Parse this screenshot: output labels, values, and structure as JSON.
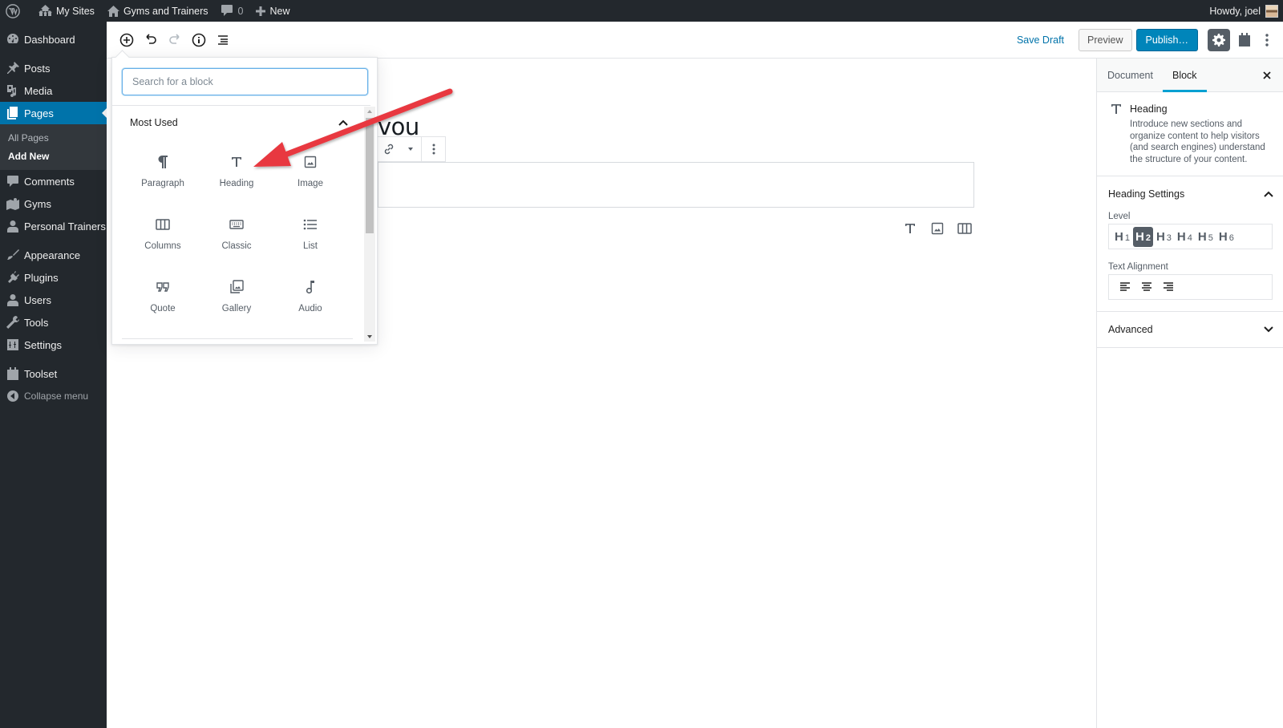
{
  "admin_bar": {
    "wp_logo": "wordpress-logo",
    "my_sites": "My Sites",
    "site_name": "Gyms and Trainers",
    "comments_count": "0",
    "new_label": "New",
    "greeting": "Howdy, joel"
  },
  "admin_menu": {
    "items": [
      {
        "label": "Dashboard",
        "icon": "dashboard-icon"
      },
      {
        "label": "Posts",
        "icon": "pin-icon"
      },
      {
        "label": "Media",
        "icon": "media-icon"
      },
      {
        "label": "Pages",
        "icon": "pages-icon",
        "current": true
      },
      {
        "label": "Comments",
        "icon": "comment-icon"
      },
      {
        "label": "Gyms",
        "icon": "map-icon"
      },
      {
        "label": "Personal Trainers",
        "icon": "user-icon"
      },
      {
        "label": "Appearance",
        "icon": "brush-icon"
      },
      {
        "label": "Plugins",
        "icon": "plug-icon"
      },
      {
        "label": "Users",
        "icon": "user-icon"
      },
      {
        "label": "Tools",
        "icon": "wrench-icon"
      },
      {
        "label": "Settings",
        "icon": "settings-icon"
      },
      {
        "label": "Toolset",
        "icon": "toolset-icon"
      },
      {
        "label": "Collapse menu",
        "icon": "collapse-icon"
      }
    ],
    "pages_submenu": [
      {
        "label": "All Pages",
        "active": false
      },
      {
        "label": "Add New",
        "active": true
      }
    ]
  },
  "editor_header": {
    "inserter_toggle": "add-block",
    "undo": "undo",
    "redo": "redo",
    "info": "content-structure",
    "outline": "block-navigation",
    "save_draft": "Save Draft",
    "preview": "Preview",
    "publish": "Publish…",
    "settings": "settings",
    "toolset": "toolset",
    "more": "more-tools"
  },
  "inserter": {
    "search_placeholder": "Search for a block",
    "search_value": "",
    "section_title": "Most Used",
    "section_expanded": true,
    "blocks": [
      {
        "label": "Paragraph",
        "icon": "paragraph-icon"
      },
      {
        "label": "Heading",
        "icon": "heading-icon"
      },
      {
        "label": "Image",
        "icon": "image-icon"
      },
      {
        "label": "Columns",
        "icon": "columns-icon"
      },
      {
        "label": "Classic",
        "icon": "keyboard-icon"
      },
      {
        "label": "List",
        "icon": "list-icon"
      },
      {
        "label": "Quote",
        "icon": "quote-icon"
      },
      {
        "label": "Gallery",
        "icon": "gallery-icon"
      },
      {
        "label": "Audio",
        "icon": "audio-icon"
      }
    ]
  },
  "canvas": {
    "title_fragment": "vou",
    "paragraph_text": "",
    "inline_inserter": [
      "heading-icon",
      "image-icon",
      "columns-icon"
    ]
  },
  "settings_sidebar": {
    "tabs": [
      {
        "label": "Document",
        "active": false
      },
      {
        "label": "Block",
        "active": true
      }
    ],
    "block_card": {
      "title": "Heading",
      "description": "Introduce new sections and organize content to help visitors (and search engines) understand the structure of your content."
    },
    "heading_settings": {
      "title": "Heading Settings",
      "expanded": true,
      "level_label": "Level",
      "levels": [
        "1",
        "2",
        "3",
        "4",
        "5",
        "6"
      ],
      "selected_level": "2",
      "alignment_label": "Text Alignment",
      "alignments": [
        "align-left",
        "align-center",
        "align-right"
      ]
    },
    "advanced": {
      "title": "Advanced",
      "expanded": false
    }
  },
  "colors": {
    "admin_bg": "#23282d",
    "admin_current": "#0073aa",
    "publish_bg": "#0085ba",
    "settings_active": "#555d66",
    "tab_indicator": "#00a0d2",
    "annotation_arrow": "#e8393f"
  },
  "annotation": {
    "type": "arrow",
    "points_to": "Heading block in inserter"
  }
}
